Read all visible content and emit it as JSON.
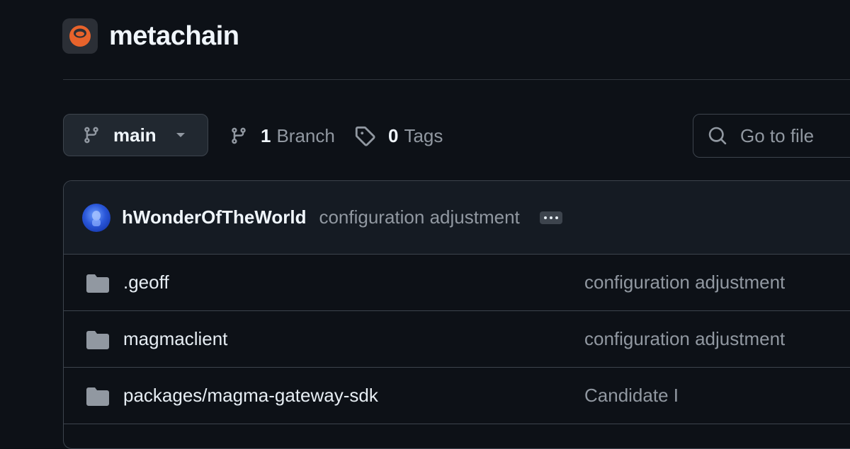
{
  "repo": {
    "name": "metachain",
    "logo_icon": "repo-logo-icon",
    "accent_color": "#e8632b"
  },
  "toolbar": {
    "branch_selector": {
      "label": "main"
    },
    "branches": {
      "count": "1",
      "label": "Branch"
    },
    "tags": {
      "count": "0",
      "label": "Tags"
    },
    "go_to_file": {
      "placeholder": "Go to file"
    }
  },
  "latest_commit": {
    "author": "hWonderOfTheWorld",
    "message": "configuration adjustment"
  },
  "files": [
    {
      "name": ".geoff",
      "type": "folder",
      "commit_message": "configuration adjustment"
    },
    {
      "name": "magmaclient",
      "type": "folder",
      "commit_message": "configuration adjustment"
    },
    {
      "name": "packages/magma-gateway-sdk",
      "type": "folder",
      "commit_message": "Candidate I"
    }
  ]
}
